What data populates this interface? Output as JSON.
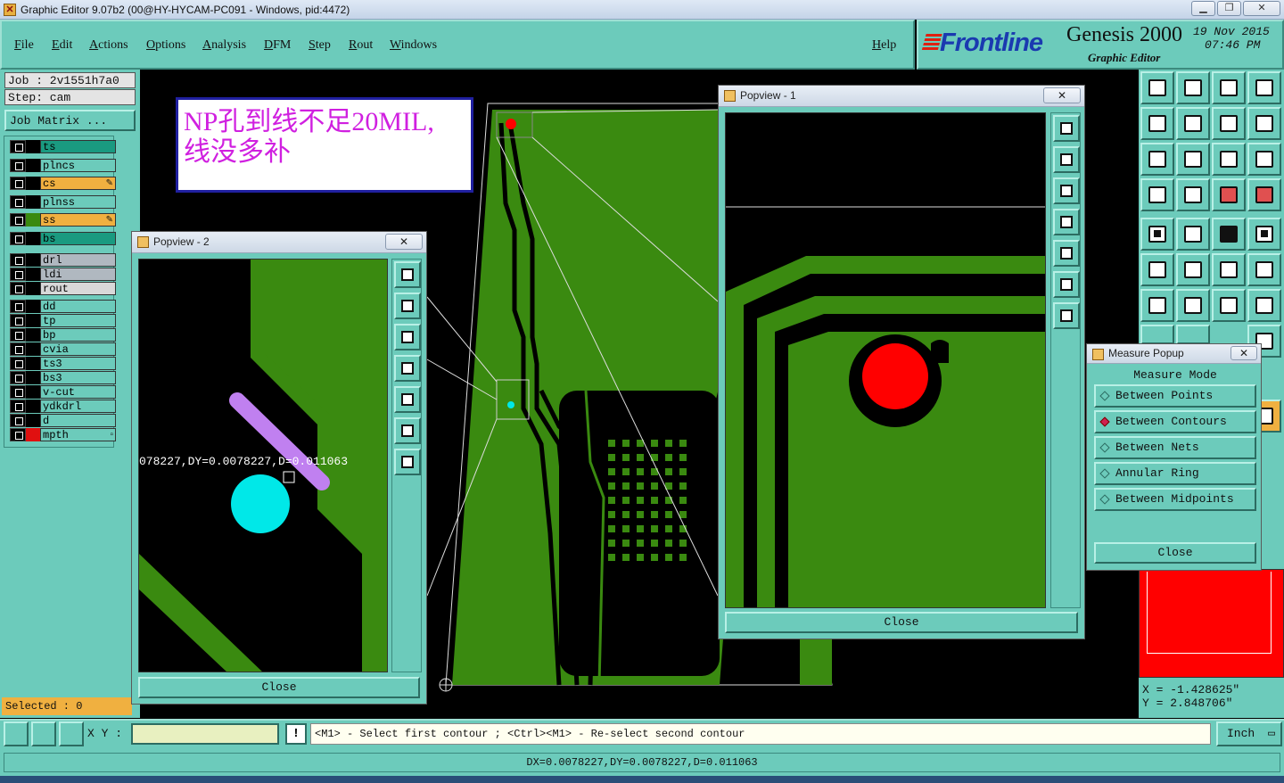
{
  "window": {
    "title": "Graphic Editor 9.07b2 (00@HY-HYCAM-PC091 - Windows, pid:4472)"
  },
  "menu": [
    "File",
    "Edit",
    "Actions",
    "Options",
    "Analysis",
    "DFM",
    "Step",
    "Rout",
    "Windows"
  ],
  "help_label": "Help",
  "logo": {
    "brand": "Frontline",
    "product": "Genesis 2000",
    "subtitle": "Graphic Editor",
    "date": "19 Nov 2015",
    "time": "07:46 PM"
  },
  "job": {
    "job_line": "Job : 2v1551h7a0",
    "step_line": "Step: cam",
    "matrix_button": "Job Matrix ..."
  },
  "layers": [
    {
      "name": "ts",
      "color": "#1a9a80",
      "swatch": "#000000"
    },
    {
      "name": "plncs",
      "color": "#6ccbbb",
      "swatch": "#000000"
    },
    {
      "name": "cs",
      "color": "#f0b040",
      "swatch": "#000000",
      "mark": "✎"
    },
    {
      "name": "plnss",
      "color": "#6ccbbb",
      "swatch": "#000000"
    },
    {
      "name": "ss",
      "color": "#f0b040",
      "swatch": "#3a8a10",
      "mark": "✎"
    },
    {
      "name": "bs",
      "color": "#1a9a80",
      "swatch": "#000000"
    },
    {
      "name": "drl",
      "color": "#b0b8c0",
      "swatch": "#000000"
    },
    {
      "name": "ldi",
      "color": "#b0b8c0",
      "swatch": "#000000"
    },
    {
      "name": "rout",
      "color": "#d8d8d8",
      "swatch": "#000000"
    },
    {
      "name": "dd",
      "color": "#6ccbbb",
      "swatch": "#000000"
    },
    {
      "name": "tp",
      "color": "#6ccbbb",
      "swatch": "#000000"
    },
    {
      "name": "bp",
      "color": "#6ccbbb",
      "swatch": "#000000"
    },
    {
      "name": "cvia",
      "color": "#6ccbbb",
      "swatch": "#000000"
    },
    {
      "name": "ts3",
      "color": "#6ccbbb",
      "swatch": "#000000"
    },
    {
      "name": "bs3",
      "color": "#6ccbbb",
      "swatch": "#000000"
    },
    {
      "name": "v-cut",
      "color": "#6ccbbb",
      "swatch": "#000000"
    },
    {
      "name": "ydkdrl",
      "color": "#6ccbbb",
      "swatch": "#000000"
    },
    {
      "name": "d",
      "color": "#6ccbbb",
      "swatch": "#000000"
    },
    {
      "name": "mpth",
      "color": "#6ccbbb",
      "swatch": "#e01010",
      "mark": "▫"
    }
  ],
  "selected": "Selected : 0",
  "annotation": {
    "line1": "NP孔到线不足20MIL,",
    "line2": "线没多补"
  },
  "popview2": {
    "title": "Popview - 2",
    "measure_text": "078227,DY=0.0078227,D=0.011063",
    "close": "Close"
  },
  "popview1": {
    "title": "Popview - 1",
    "close": "Close"
  },
  "measure": {
    "title": "Measure Popup",
    "mode_label": "Measure Mode",
    "options": [
      "Between Points",
      "Between Contours",
      "Between Nets",
      "Annular Ring",
      "Between Midpoints"
    ],
    "selected_index": 1,
    "close": "Close"
  },
  "coords": {
    "x": "X = -1.428625\"",
    "y": "Y = 2.848706\""
  },
  "status": {
    "xy_label": "X Y :",
    "xy_value": "",
    "prompt": "<M1> - Select first contour ; <Ctrl><M1> - Re-select second contour",
    "units": "Inch",
    "alert": "!"
  },
  "result": "DX=0.0078227,DY=0.0078227,D=0.011063",
  "colors": {
    "panel": "#6ccbbb",
    "copper": "#3a8a10",
    "highlight": "#c080f0",
    "drill": "#00e8e8",
    "np_hole": "#ff0000"
  }
}
